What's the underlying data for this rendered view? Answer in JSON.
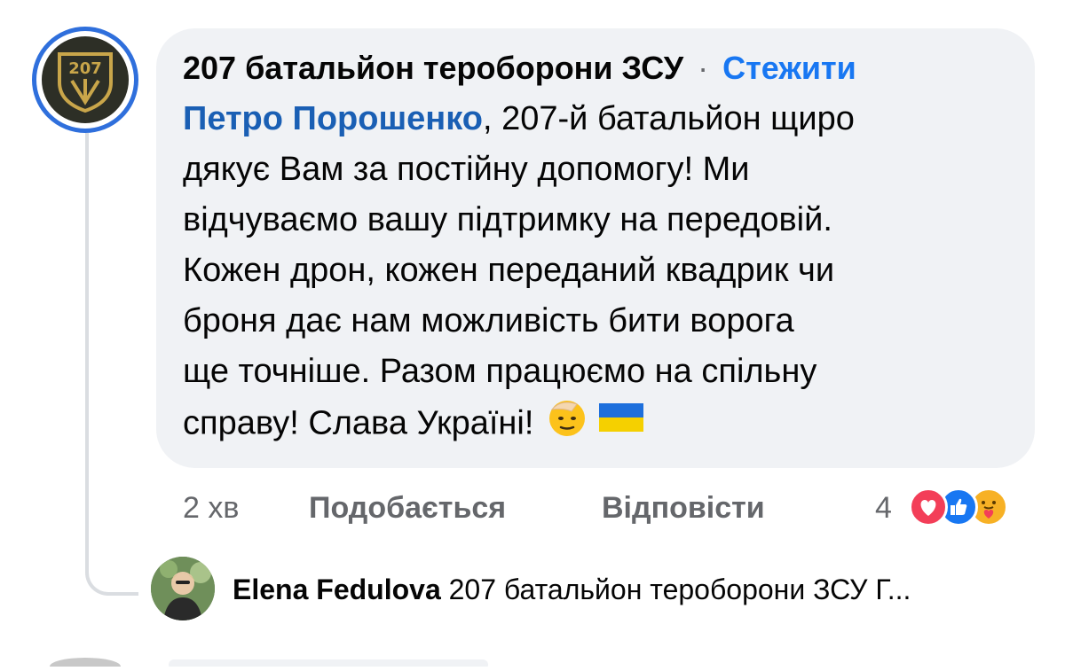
{
  "comment": {
    "author": "207 батальйон тероборони ЗСУ",
    "separator": "·",
    "follow_label": "Стежити",
    "mention": "Петро Порошенко",
    "text_lines": [
      ", 207-й батальйон щиро",
      "дякує Вам за постійну допомогу! Ми",
      "відчуваємо вашу підтримку на передовій.",
      "Кожен дрон, кожен переданий квадрик чи",
      "броня дає нам можливість бити ворога",
      "ще точніше. Разом працюємо на спільну",
      "справу! Слава Україні!"
    ],
    "emojis": [
      "saluting-face",
      "ukraine-flag"
    ]
  },
  "actions": {
    "time": "2 хв",
    "like_label": "Подобається",
    "reply_label": "Відповісти"
  },
  "reactions": {
    "count": "4",
    "icons": [
      "love-reaction",
      "like-reaction",
      "care-reaction"
    ]
  },
  "reply": {
    "author": "Elena Fedulova",
    "preview": "207 батальйон тероборони ЗСУ Г..."
  },
  "colors": {
    "bubble": "#f0f2f5",
    "link_blue": "#1877f2",
    "mention_blue": "#1a5fb4",
    "secondary_text": "#65676b",
    "avatar_ring": "#2f6fdc"
  }
}
